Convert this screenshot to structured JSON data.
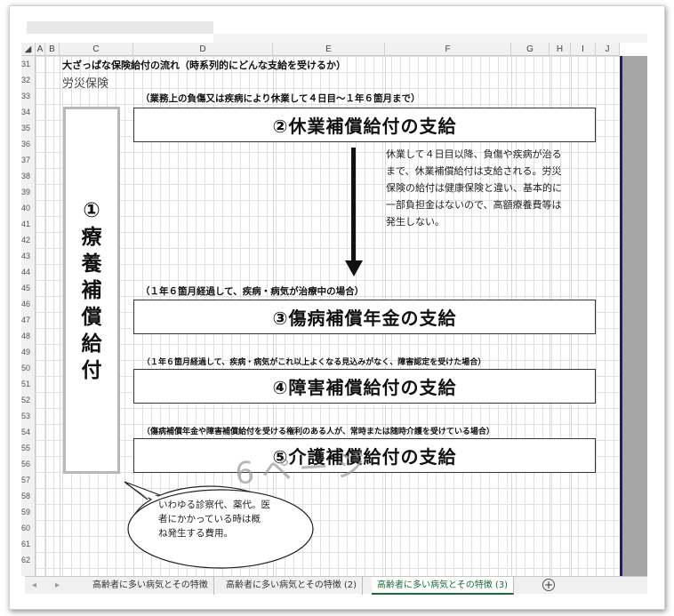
{
  "columns": [
    "A",
    "B",
    "C",
    "D",
    "E",
    "F",
    "G",
    "H",
    "I",
    "J"
  ],
  "rows": [
    "31",
    "32",
    "33",
    "34",
    "35",
    "36",
    "37",
    "38",
    "39",
    "40",
    "41",
    "42",
    "43",
    "44",
    "45",
    "46",
    "47",
    "48",
    "49",
    "50",
    "51",
    "52",
    "53",
    "54",
    "55",
    "56",
    "57",
    "58",
    "59",
    "60",
    "61",
    "62"
  ],
  "sheet": {
    "title": "大ざっぱな保険給付の流れ（時系列的にどんな支給を受けるか）",
    "subtitle": "労災保険",
    "vertical_box": {
      "number": "①",
      "chars": [
        "療",
        "養",
        "補",
        "償",
        "給",
        "付"
      ]
    },
    "step2": {
      "condition": "（業務上の負傷又は疾病により休業して４日目～１年６箇月まで）",
      "label": "②休業補償給付の支給"
    },
    "description": [
      "休業して４日目以降、負傷や疾病が治る",
      "まで、休業補償給付は支給される。労災",
      "保険の給付は健康保険と違い、基本的に",
      "一部負担金はないので、高額療養費等は",
      "発生しない。"
    ],
    "step3": {
      "condition": "（１年６箇月経過して、疾病・病気が治療中の場合）",
      "label": "③傷病補償年金の支給"
    },
    "step4": {
      "condition": "（１年６箇月経過して、疾病・病気がこれ以上よくなる見込みがなく、障害認定を受けた場合）",
      "label": "④障害補償給付の支給"
    },
    "step5": {
      "condition": "（傷病補償年金や障害補償給付を受ける権利のある人が、常時または随時介護を受けている場合）",
      "label": "⑤介護補償給付の支給"
    },
    "watermark": "6ページ",
    "bubble": [
      "いわゆる診察代、薬代。医",
      "者にかかっている時は概",
      "ね発生する費用。"
    ]
  },
  "tabs": [
    "高齢者に多い病気とその特徴",
    "高齢者に多い病気とその特徴 (2)",
    "高齢者に多い病気とその特徴 (3)"
  ],
  "active_tab": 2,
  "icons": {
    "nav_prev": "◂",
    "nav_next": "▸",
    "add_sheet": "+"
  }
}
